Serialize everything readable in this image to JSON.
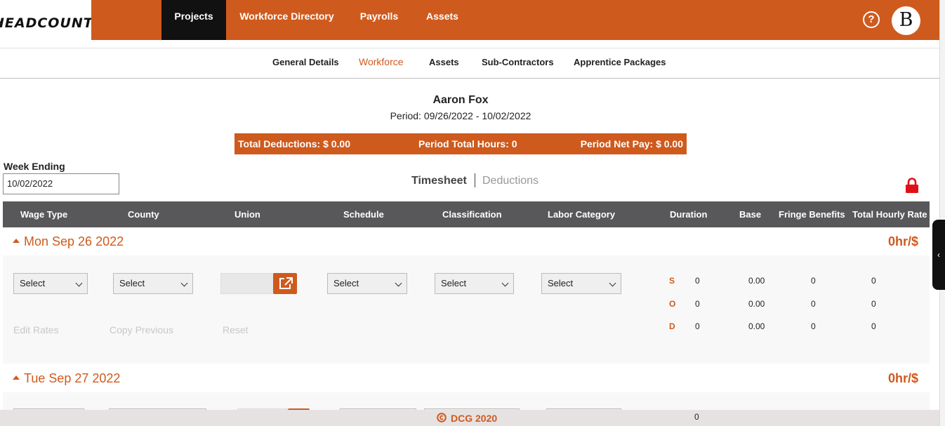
{
  "app": {
    "logo_text": "HEADCOUNT"
  },
  "nav": {
    "projects": "Projects",
    "workforce_directory": "Workforce Directory",
    "payrolls": "Payrolls",
    "assets": "Assets",
    "help_symbol": "?",
    "avatar_initial": "B"
  },
  "subnav": {
    "general_details": "General Details",
    "workforce": "Workforce",
    "assets": "Assets",
    "sub_contractors": "Sub-Contractors",
    "apprentice_packages": "Apprentice Packages"
  },
  "employee": {
    "name": "Aaron Fox",
    "period": "Period: 09/26/2022 - 10/02/2022"
  },
  "summary": {
    "total_deductions": "Total Deductions: $ 0.00",
    "period_total_hours": "Period Total Hours: 0",
    "period_net_pay": "Period Net Pay: $ 0.00"
  },
  "week_ending": {
    "label": "Week Ending",
    "value": "10/02/2022"
  },
  "tabs": {
    "timesheet": "Timesheet",
    "deductions": "Deductions"
  },
  "columns": {
    "wage_type": "Wage Type",
    "county": "County",
    "union": "Union",
    "schedule": "Schedule",
    "classification": "Classification",
    "labor_category": "Labor Category",
    "duration": "Duration",
    "base": "Base",
    "fringe_benefits": "Fringe Benefits",
    "total_hourly_rate": "Total Hourly Rate"
  },
  "days": [
    {
      "title": "Mon Sep 26 2022",
      "rate": "0hr/$",
      "select_placeholder": "Select",
      "actions": {
        "edit_rates": "Edit Rates",
        "copy_previous": "Copy Previous",
        "reset": "Reset"
      },
      "rows": [
        {
          "label": "S",
          "duration": "0",
          "base": "0.00",
          "fringe": "0",
          "total": "0"
        },
        {
          "label": "O",
          "duration": "0",
          "base": "0.00",
          "fringe": "0",
          "total": "0"
        },
        {
          "label": "D",
          "duration": "0",
          "base": "0.00",
          "fringe": "0",
          "total": "0"
        }
      ]
    },
    {
      "title": "Tue Sep 27 2022",
      "rate": "0hr/$",
      "partial_duration": "0"
    }
  ],
  "footer": {
    "copyright": "DCG 2020"
  },
  "colors": {
    "accent": "#cf5a1d",
    "nav_active": "#111111",
    "table_header": "#58585a",
    "lock": "#e0101a"
  },
  "icons": [
    "help-icon",
    "external-link-icon",
    "lock-icon",
    "chevron-down-icon",
    "caret-up-icon",
    "copyright-icon",
    "chevron-left-icon"
  ]
}
